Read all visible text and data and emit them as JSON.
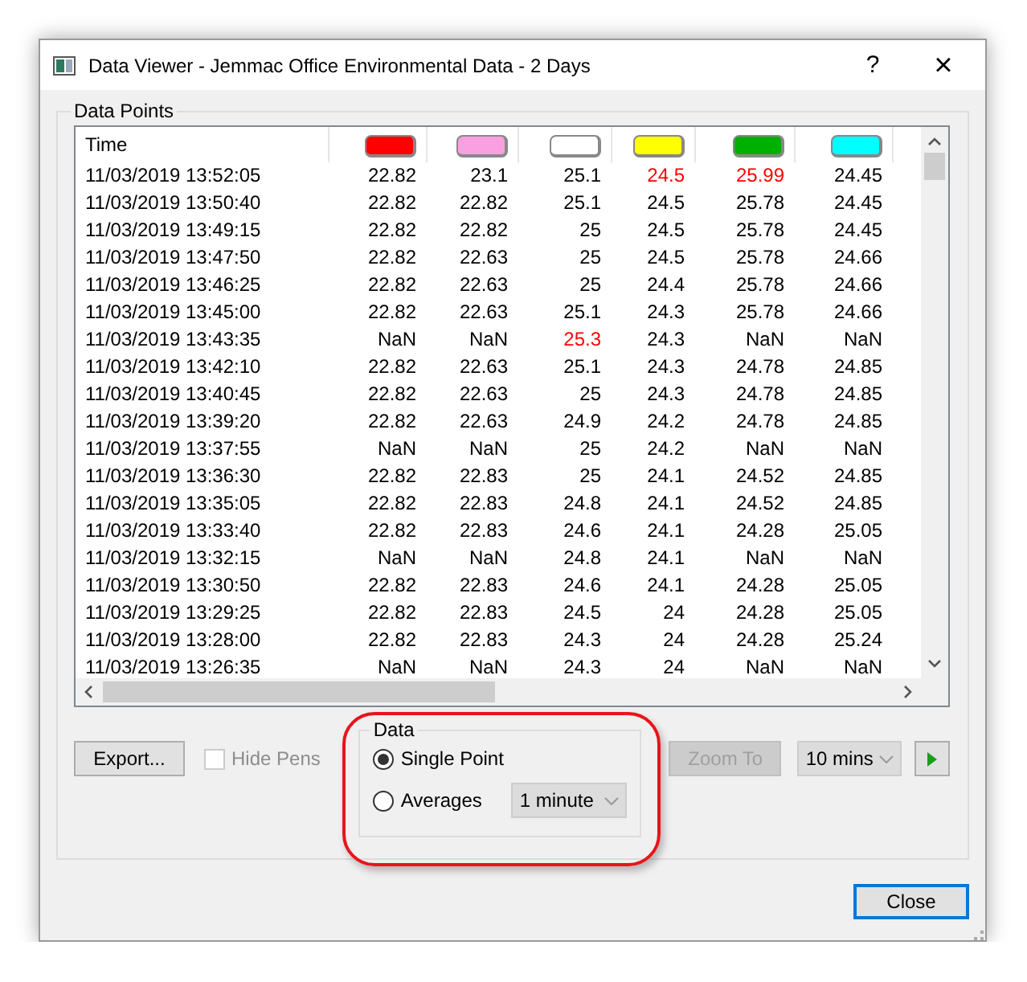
{
  "window": {
    "title": "Data Viewer - Jemmac Office Environmental Data - 2 Days",
    "help": "?",
    "close": "×"
  },
  "data_points": {
    "label": "Data Points",
    "columns": [
      {
        "kind": "time",
        "label": "Time"
      },
      {
        "kind": "pen",
        "color": "#ff0000"
      },
      {
        "kind": "pen",
        "color": "#f9a0e0"
      },
      {
        "kind": "pen",
        "color": "#ffffff"
      },
      {
        "kind": "pen",
        "color": "#ffff00"
      },
      {
        "kind": "pen",
        "color": "#00b000"
      },
      {
        "kind": "pen",
        "color": "#00ffff"
      }
    ],
    "rows": [
      {
        "time": "11/03/2019 13:52:05",
        "values": [
          "22.82",
          "23.1",
          "25.1",
          "24.5",
          "25.99",
          "24.45"
        ],
        "alarm": [
          false,
          false,
          false,
          true,
          true,
          false
        ]
      },
      {
        "time": "11/03/2019 13:50:40",
        "values": [
          "22.82",
          "22.82",
          "25.1",
          "24.5",
          "25.78",
          "24.45"
        ],
        "alarm": [
          false,
          false,
          false,
          false,
          false,
          false
        ]
      },
      {
        "time": "11/03/2019 13:49:15",
        "values": [
          "22.82",
          "22.82",
          "25",
          "24.5",
          "25.78",
          "24.45"
        ],
        "alarm": [
          false,
          false,
          false,
          false,
          false,
          false
        ]
      },
      {
        "time": "11/03/2019 13:47:50",
        "values": [
          "22.82",
          "22.63",
          "25",
          "24.5",
          "25.78",
          "24.66"
        ],
        "alarm": [
          false,
          false,
          false,
          false,
          false,
          false
        ]
      },
      {
        "time": "11/03/2019 13:46:25",
        "values": [
          "22.82",
          "22.63",
          "25",
          "24.4",
          "25.78",
          "24.66"
        ],
        "alarm": [
          false,
          false,
          false,
          false,
          false,
          false
        ]
      },
      {
        "time": "11/03/2019 13:45:00",
        "values": [
          "22.82",
          "22.63",
          "25.1",
          "24.3",
          "25.78",
          "24.66"
        ],
        "alarm": [
          false,
          false,
          false,
          false,
          false,
          false
        ]
      },
      {
        "time": "11/03/2019 13:43:35",
        "values": [
          "NaN",
          "NaN",
          "25.3",
          "24.3",
          "NaN",
          "NaN"
        ],
        "alarm": [
          false,
          false,
          true,
          false,
          false,
          false
        ]
      },
      {
        "time": "11/03/2019 13:42:10",
        "values": [
          "22.82",
          "22.63",
          "25.1",
          "24.3",
          "24.78",
          "24.85"
        ],
        "alarm": [
          false,
          false,
          false,
          false,
          false,
          false
        ]
      },
      {
        "time": "11/03/2019 13:40:45",
        "values": [
          "22.82",
          "22.63",
          "25",
          "24.3",
          "24.78",
          "24.85"
        ],
        "alarm": [
          false,
          false,
          false,
          false,
          false,
          false
        ]
      },
      {
        "time": "11/03/2019 13:39:20",
        "values": [
          "22.82",
          "22.63",
          "24.9",
          "24.2",
          "24.78",
          "24.85"
        ],
        "alarm": [
          false,
          false,
          false,
          false,
          false,
          false
        ]
      },
      {
        "time": "11/03/2019 13:37:55",
        "values": [
          "NaN",
          "NaN",
          "25",
          "24.2",
          "NaN",
          "NaN"
        ],
        "alarm": [
          false,
          false,
          false,
          false,
          false,
          false
        ]
      },
      {
        "time": "11/03/2019 13:36:30",
        "values": [
          "22.82",
          "22.83",
          "25",
          "24.1",
          "24.52",
          "24.85"
        ],
        "alarm": [
          false,
          false,
          false,
          false,
          false,
          false
        ]
      },
      {
        "time": "11/03/2019 13:35:05",
        "values": [
          "22.82",
          "22.83",
          "24.8",
          "24.1",
          "24.52",
          "24.85"
        ],
        "alarm": [
          false,
          false,
          false,
          false,
          false,
          false
        ]
      },
      {
        "time": "11/03/2019 13:33:40",
        "values": [
          "22.82",
          "22.83",
          "24.6",
          "24.1",
          "24.28",
          "25.05"
        ],
        "alarm": [
          false,
          false,
          false,
          false,
          false,
          false
        ]
      },
      {
        "time": "11/03/2019 13:32:15",
        "values": [
          "NaN",
          "NaN",
          "24.8",
          "24.1",
          "NaN",
          "NaN"
        ],
        "alarm": [
          false,
          false,
          false,
          false,
          false,
          false
        ]
      },
      {
        "time": "11/03/2019 13:30:50",
        "values": [
          "22.82",
          "22.83",
          "24.6",
          "24.1",
          "24.28",
          "25.05"
        ],
        "alarm": [
          false,
          false,
          false,
          false,
          false,
          false
        ]
      },
      {
        "time": "11/03/2019 13:29:25",
        "values": [
          "22.82",
          "22.83",
          "24.5",
          "24",
          "24.28",
          "25.05"
        ],
        "alarm": [
          false,
          false,
          false,
          false,
          false,
          false
        ]
      },
      {
        "time": "11/03/2019 13:28:00",
        "values": [
          "22.82",
          "22.83",
          "24.3",
          "24",
          "24.28",
          "25.24"
        ],
        "alarm": [
          false,
          false,
          false,
          false,
          false,
          false
        ]
      },
      {
        "time": "11/03/2019 13:26:35",
        "values": [
          "NaN",
          "NaN",
          "24.3",
          "24",
          "NaN",
          "NaN"
        ],
        "alarm": [
          false,
          false,
          false,
          false,
          false,
          false
        ]
      }
    ]
  },
  "controls": {
    "export": "Export...",
    "hide_pens": {
      "label": "Hide Pens",
      "checked": false,
      "disabled": true
    },
    "data_group": {
      "label": "Data",
      "options": [
        {
          "label": "Single Point",
          "selected": true
        },
        {
          "label": "Averages",
          "selected": false
        }
      ],
      "average_interval": "1 minute"
    },
    "zoom_to": {
      "label": "Zoom To",
      "disabled": true
    },
    "zoom_interval": "10 mins"
  },
  "close_button": "Close"
}
